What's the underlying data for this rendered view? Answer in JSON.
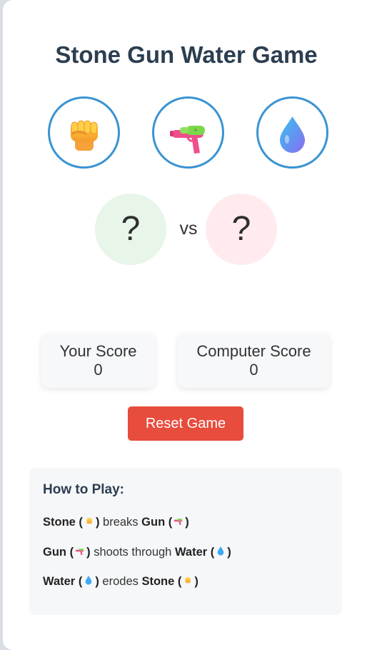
{
  "game": {
    "title": "Stone Gun Water Game"
  },
  "choices": [
    {
      "id": "stone",
      "icon": "raised-fist-icon",
      "label": "Stone"
    },
    {
      "id": "gun",
      "icon": "water-pistol-icon",
      "label": "Gun"
    },
    {
      "id": "water",
      "icon": "droplet-icon",
      "label": "Water"
    }
  ],
  "battle": {
    "player_choice": "?",
    "vs_label": "vs",
    "computer_choice": "?"
  },
  "scores": {
    "player_label": "Your Score",
    "player_value": "0",
    "computer_label": "Computer Score",
    "computer_value": "0"
  },
  "reset_label": "Reset Game",
  "rules": {
    "heading": "How to Play:",
    "items": [
      {
        "subject": "Stone",
        "verb": "breaks",
        "object": "Gun"
      },
      {
        "subject": "Gun",
        "verb": "shoots through",
        "object": "Water"
      },
      {
        "subject": "Water",
        "verb": "erodes",
        "object": "Stone"
      }
    ]
  },
  "colors": {
    "title": "#2c3e50",
    "choice_border": "#3a94d1",
    "player_circle": "#e8f5e9",
    "computer_circle": "#ffebee",
    "reset_button": "#e74c3c",
    "panel_bg": "#f6f7f9"
  }
}
